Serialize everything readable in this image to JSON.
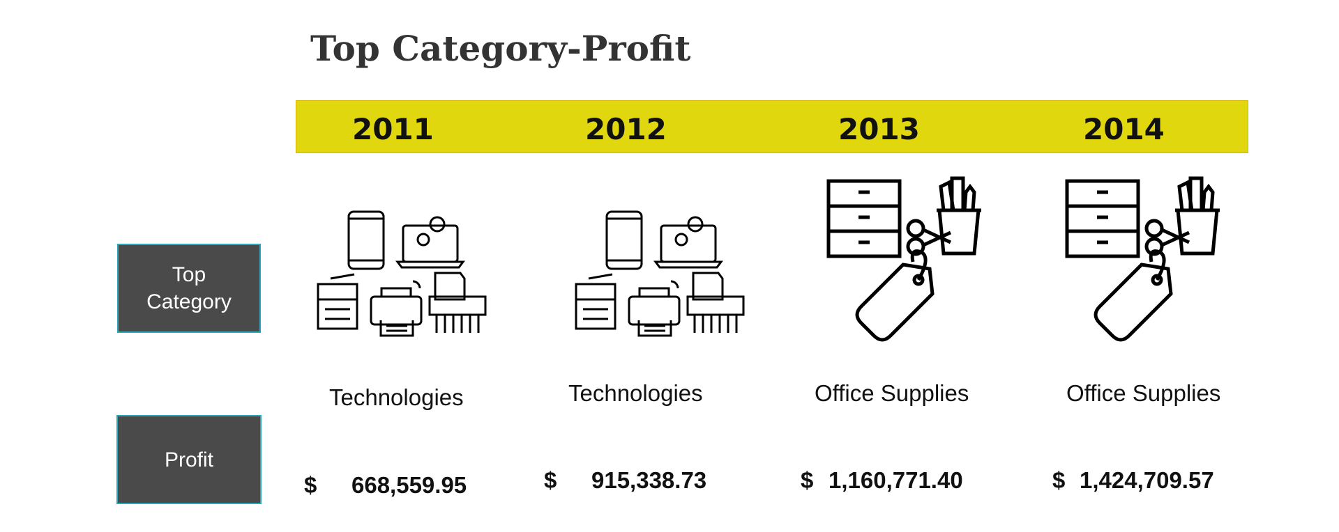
{
  "title": "Top Category-Profit",
  "row_labels": {
    "top_category": "Top\nCategory",
    "profit": "Profit"
  },
  "years": [
    "2011",
    "2012",
    "2013",
    "2014"
  ],
  "columns": [
    {
      "year": "2011",
      "category": "Technologies",
      "currency": "$",
      "profit": "668,559.95",
      "icon": "technology-devices-icon"
    },
    {
      "year": "2012",
      "category": "Technologies",
      "currency": "$",
      "profit": "915,338.73",
      "icon": "technology-devices-icon"
    },
    {
      "year": "2013",
      "category": "Office Supplies",
      "currency": "$",
      "profit": "1,160,771.40",
      "icon": "office-supplies-icon"
    },
    {
      "year": "2014",
      "category": "Office Supplies",
      "currency": "$",
      "profit": "1,424,709.57",
      "icon": "office-supplies-icon"
    }
  ],
  "colors": {
    "band": "#e0d70f",
    "side_box": "#4a4a4a",
    "side_box_border": "#2aa7b8",
    "title": "#333333"
  }
}
